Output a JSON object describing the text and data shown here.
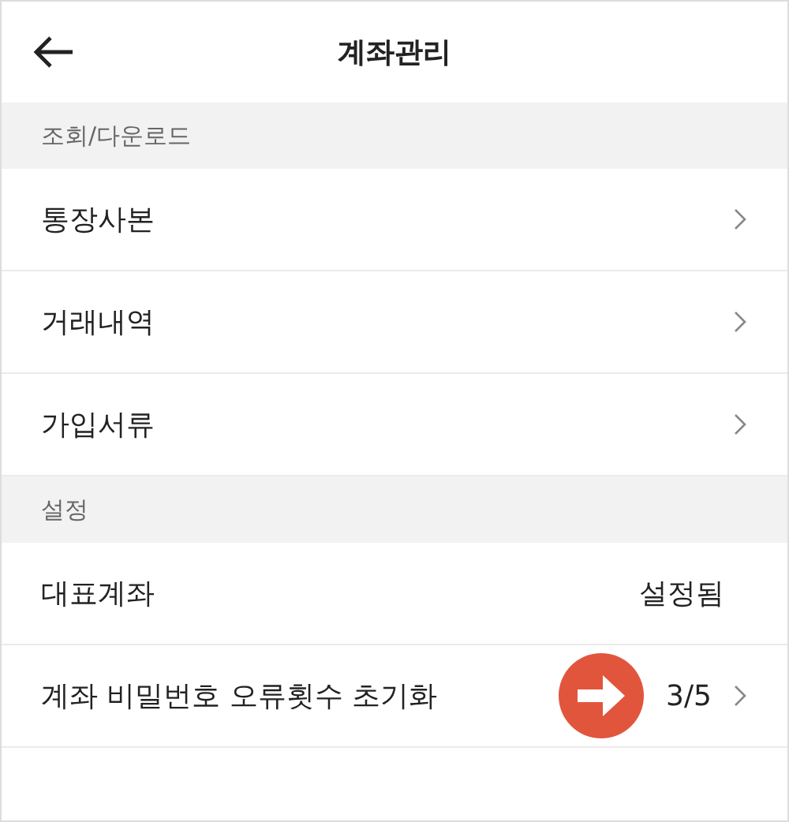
{
  "header": {
    "title": "계좌관리"
  },
  "sections": [
    {
      "title": "조회/다운로드",
      "items": [
        {
          "kind": "link",
          "label": "통장사본",
          "annotated": false
        },
        {
          "kind": "link",
          "label": "거래내역",
          "annotated": false
        },
        {
          "kind": "link",
          "label": "가입서류",
          "annotated": false
        }
      ]
    },
    {
      "title": "설정",
      "items": [
        {
          "kind": "value",
          "label": "대표계좌",
          "value": "설정됨",
          "annotated": false
        },
        {
          "kind": "link",
          "label": "계좌 비밀번호 오류횟수 초기화",
          "value": "3/5",
          "annotated": true
        }
      ]
    }
  ]
}
